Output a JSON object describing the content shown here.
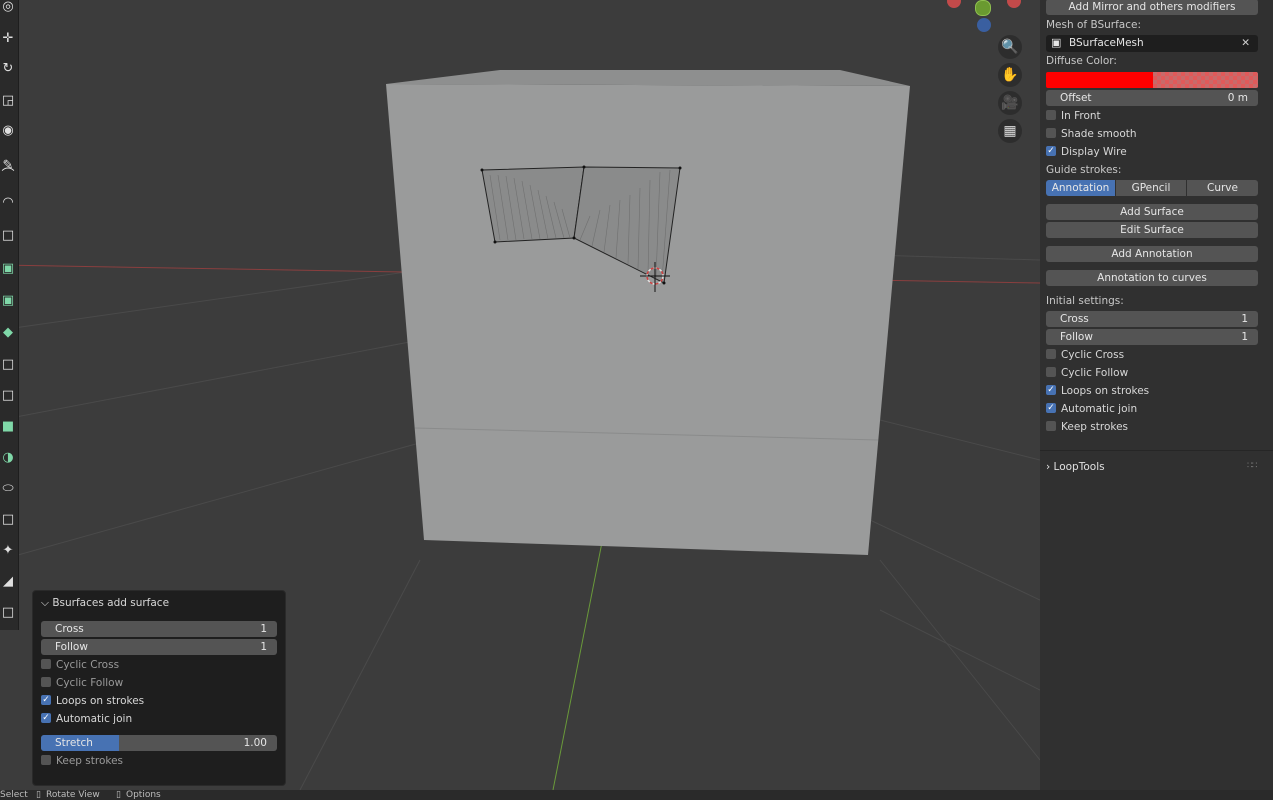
{
  "panel": {
    "add_mirror_button": "Add Mirror and others modifiers",
    "mesh_label": "Mesh of BSurface:",
    "mesh_value": "BSurfaceMesh",
    "diffuse_label": "Diffuse Color:",
    "diffuse_color": "#ff0000",
    "offset_label": "Offset",
    "offset_value": "0 m",
    "in_front": "In Front",
    "shade_smooth": "Shade smooth",
    "display_wire": "Display Wire",
    "guide_label": "Guide strokes:",
    "guide_tabs": [
      "Annotation",
      "GPencil",
      "Curve"
    ],
    "add_surface": "Add Surface",
    "edit_surface": "Edit Surface",
    "add_annotation": "Add Annotation",
    "annotation_to_curves": "Annotation to curves",
    "initial_label": "Initial settings:",
    "cross_label": "Cross",
    "cross_value": "1",
    "follow_label": "Follow",
    "follow_value": "1",
    "cyclic_cross": "Cyclic Cross",
    "cyclic_follow": "Cyclic Follow",
    "loops_on_strokes": "Loops on strokes",
    "automatic_join": "Automatic join",
    "keep_strokes": "Keep strokes",
    "looptools": "LoopTools"
  },
  "operator": {
    "title": "Bsurfaces add surface",
    "cross_label": "Cross",
    "cross_value": "1",
    "follow_label": "Follow",
    "follow_value": "1",
    "cyclic_cross": "Cyclic Cross",
    "cyclic_follow": "Cyclic Follow",
    "loops_on_strokes": "Loops on strokes",
    "automatic_join": "Automatic join",
    "stretch_label": "Stretch",
    "stretch_value": "1.00",
    "stretch_fraction": 0.33,
    "keep_strokes": "Keep strokes"
  },
  "statusbar": {
    "select": "Select",
    "rotate_view": "Rotate View",
    "options": "Options"
  },
  "colors": {
    "accent": "#4772b3",
    "x_axis": "#b05050",
    "y_axis": "#6a9a3a",
    "cube": "#9a9b9b"
  }
}
